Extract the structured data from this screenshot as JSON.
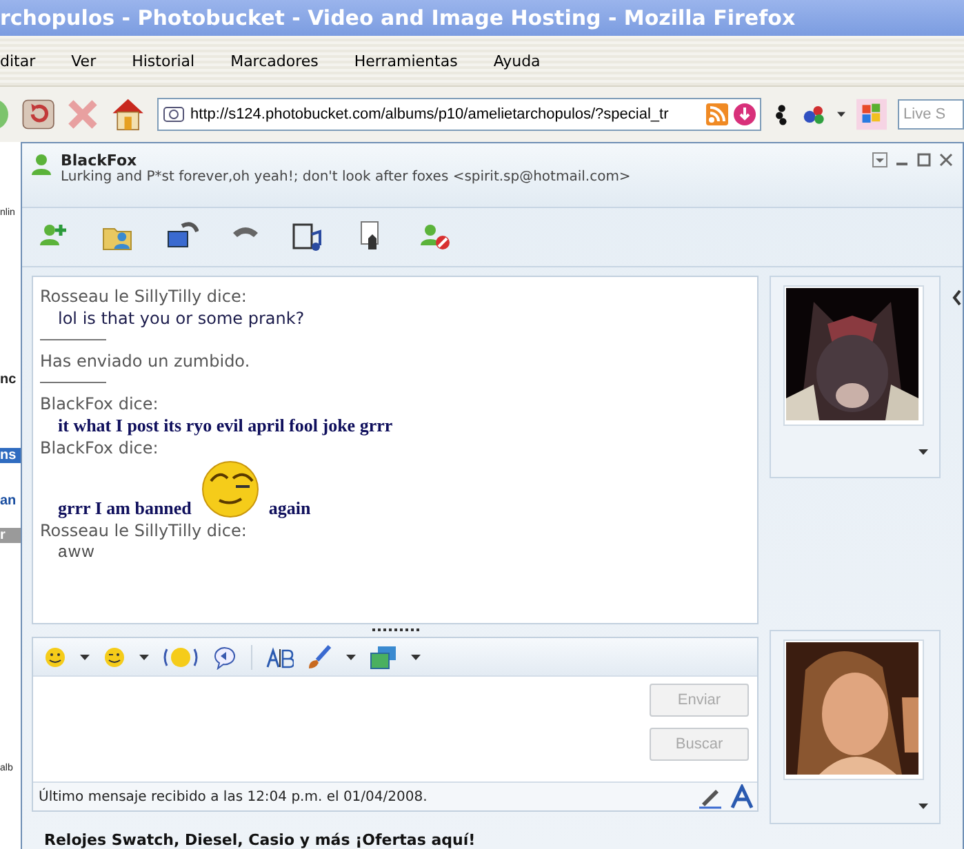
{
  "browser": {
    "title": "rchopulos - Photobucket - Video and Image Hosting - Mozilla Firefox",
    "menu": [
      "ditar",
      "Ver",
      "Historial",
      "Marcadores",
      "Herramientas",
      "Ayuda"
    ],
    "url": "http://s124.photobucket.com/albums/p10/amelietarchopulos/?special_tr",
    "search": {
      "placeholder": "Live S"
    }
  },
  "page_fragments": [
    {
      "kind": "field",
      "text": "nlin"
    },
    {
      "kind": "heading",
      "text": "nc"
    },
    {
      "kind": "tab",
      "text": "ns"
    },
    {
      "kind": "link",
      "text": "an"
    },
    {
      "kind": "button",
      "text": "r"
    },
    {
      "kind": "field",
      "text": "alb"
    }
  ],
  "conversation": {
    "contact": {
      "name": "BlackFox",
      "status": "Lurking and P*st forever,oh yeah!; don't look after foxes <spirit.sp@hotmail.com>"
    },
    "messages": [
      {
        "kind": "sender",
        "text": "Rosseau le SillyTilly dice:"
      },
      {
        "kind": "fun",
        "text": "lol is that you or some prank?"
      },
      {
        "kind": "divider"
      },
      {
        "kind": "notice",
        "text": "Has enviado un zumbido."
      },
      {
        "kind": "divider"
      },
      {
        "kind": "sender",
        "text": "BlackFox dice:"
      },
      {
        "kind": "bold",
        "text": "it what I post its ryo evil april fool joke grrr"
      },
      {
        "kind": "sender",
        "text": "BlackFox dice:"
      },
      {
        "kind": "emoticon",
        "before": "grrr I am banned",
        "after": "again"
      },
      {
        "kind": "sender",
        "text": "Rosseau le SillyTilly dice:"
      },
      {
        "kind": "thin",
        "text": "aww"
      }
    ],
    "buttons": [
      {
        "label": "Enviar",
        "disabled": true
      },
      {
        "label": "Buscar",
        "disabled": true
      }
    ],
    "status": "Último mensaje recibido a las 12:04 p.m. el 01/04/2008.",
    "ad": "Relojes Swatch, Diesel, Casio y más ¡Ofertas aquí!"
  }
}
